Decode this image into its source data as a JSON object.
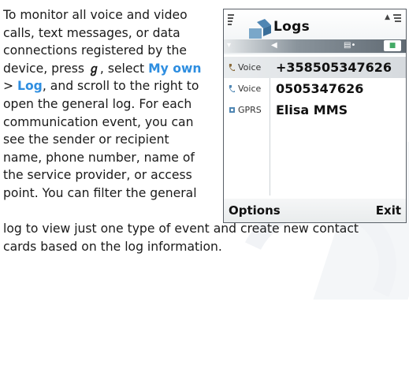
{
  "text": {
    "line1": "To monitor all voice and video",
    "line2": "calls, text messages, or data",
    "line3": "connections registered by the",
    "line4_pre": "device, press ",
    "line4_mid": ", select ",
    "line4_link": "My own",
    "line5_pre": "> ",
    "line5_link": "Log",
    "line5_post": ", and scroll to the right to",
    "line6": "open the general log. For each",
    "line7": "communication event, you can",
    "line8": "see the sender or recipient",
    "line9": "name, phone number, name of",
    "line10": "the service provider, or access",
    "line11": "point. You can filter the general",
    "line12": "log to view just one type of event and create new contact",
    "line13": "cards based on the log information.",
    "menu_key_glyph": "ℊ"
  },
  "phone": {
    "title": "Logs",
    "rows": [
      {
        "type": "Voice",
        "name": "+358505347626"
      },
      {
        "type": "Voice",
        "name": "0505347626"
      },
      {
        "type": "GPRS",
        "name": "Elisa MMS"
      }
    ],
    "softkey_left": "Options",
    "softkey_right": "Exit"
  },
  "colors": {
    "link": "#2e8ee0"
  }
}
